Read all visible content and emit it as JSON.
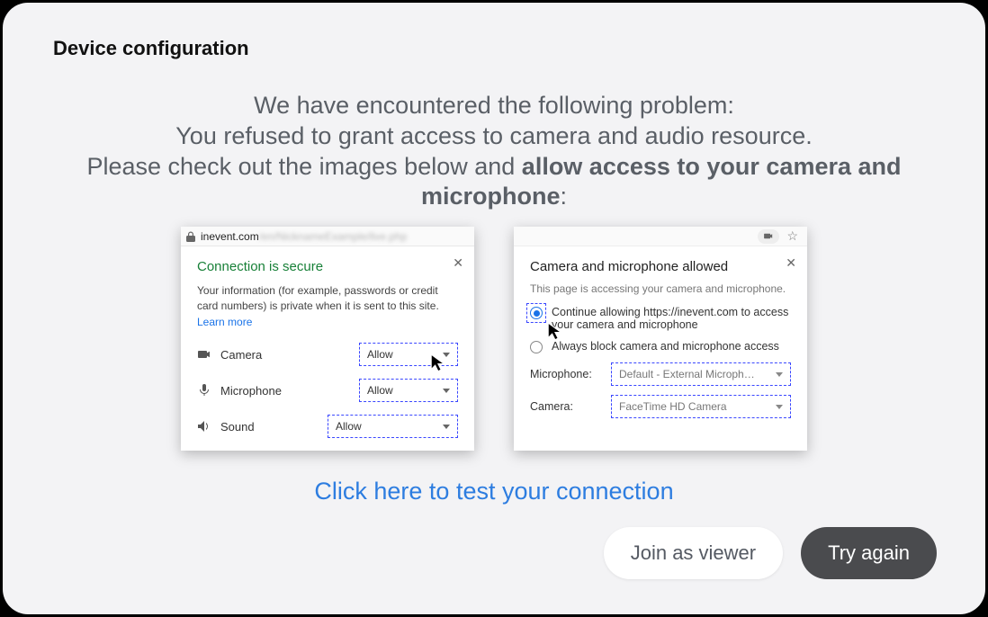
{
  "header": {
    "title": "Device configuration"
  },
  "message": {
    "line1": "We have encountered the following problem:",
    "line2": "You refused to grant access to camera and audio resource.",
    "line3_pre": "Please check out the images below and ",
    "line3_bold": "allow access to your camera and microphone",
    "line3_post": ":"
  },
  "left_popup": {
    "url_domain": "inevent.com",
    "url_rest": "/en/NicknameExample/live.php",
    "secure_title": "Connection is secure",
    "secure_desc": "Your information (for example, passwords or credit card numbers) is private when it is sent to this site. ",
    "learn_more": "Learn more",
    "perm_camera_label": "Camera",
    "perm_mic_label": "Microphone",
    "perm_sound_label": "Sound",
    "allow_value": "Allow"
  },
  "right_popup": {
    "title": "Camera and microphone allowed",
    "subtitle": "This page is accessing your camera and microphone.",
    "option_allow": "Continue allowing https://inevent.com to access your camera and microphone",
    "option_block": "Always block camera and microphone access",
    "mic_label": "Microphone:",
    "mic_value": "Default - External Microph…",
    "cam_label": "Camera:",
    "cam_value": "FaceTime HD Camera"
  },
  "test_link": "Click here to test your connection",
  "actions": {
    "join": "Join as viewer",
    "retry": "Try again"
  }
}
